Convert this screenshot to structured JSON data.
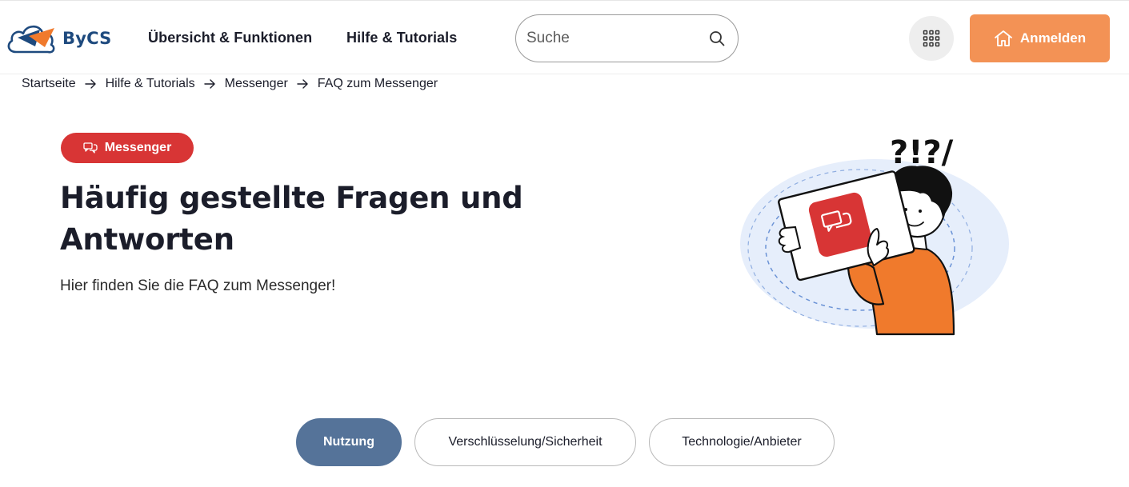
{
  "header": {
    "logo_text": "ByCS",
    "nav": [
      {
        "label": "Übersicht & Funktionen"
      },
      {
        "label": "Hilfe & Tutorials"
      }
    ],
    "search": {
      "placeholder": "Suche",
      "value": ""
    },
    "apps_icon": "grid-icon",
    "login_label": "Anmelden",
    "login_icon": "home-icon"
  },
  "breadcrumb": [
    "Startseite",
    "Hilfe & Tutorials",
    "Messenger",
    "FAQ zum Messenger"
  ],
  "hero": {
    "badge_label": "Messenger",
    "badge_icon": "chat-bubbles-icon",
    "title": "Häufig gestellte Fragen und Antworten",
    "subtitle": "Hier finden Sie die FAQ zum Messenger!",
    "illustration_text": "?!?/"
  },
  "tabs": [
    {
      "label": "Nutzung",
      "active": true
    },
    {
      "label": "Verschlüsselung/Sicherheit",
      "active": false
    },
    {
      "label": "Technologie/Anbieter",
      "active": false
    }
  ],
  "colors": {
    "accent_orange": "#f39255",
    "badge_red": "#d83535",
    "tab_active": "#557399",
    "logo_blue": "#1e4a7e"
  }
}
